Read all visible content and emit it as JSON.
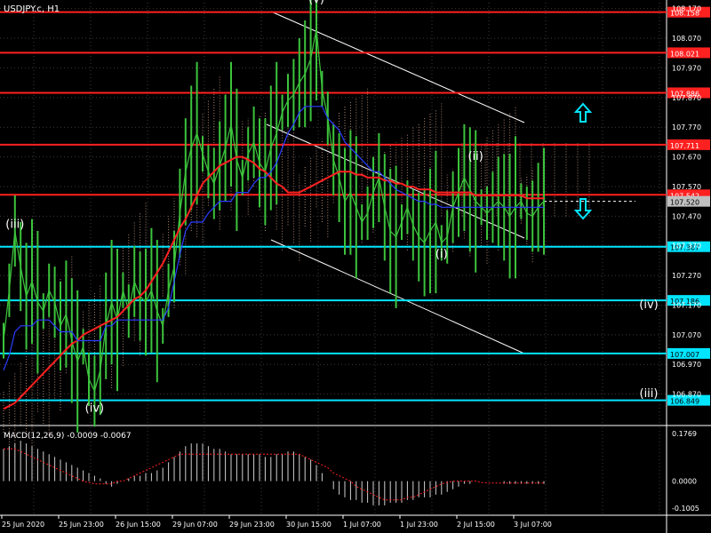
{
  "symbol_label": "USDJPY.c, H1",
  "macd_label": "MACD(12,26,9) -0.0009 -0.0067",
  "chart_data": {
    "type": "line",
    "main_axis": {
      "ylim": [
        106.77,
        108.19
      ],
      "ticks": [
        "108.170",
        "108.070",
        "107.970",
        "107.870",
        "107.770",
        "107.670",
        "107.570",
        "107.470",
        "107.370",
        "107.270",
        "107.170",
        "107.070",
        "106.970",
        "106.870"
      ]
    },
    "time_labels": [
      "25 Jun 2020",
      "25 Jun 23:00",
      "26 Jun 15:00",
      "29 Jun 07:00",
      "29 Jun 23:00",
      "30 Jun 15:00",
      "1 Jul 07:00",
      "1 Jul 23:00",
      "2 Jul 15:00",
      "3 Jul 07:00"
    ],
    "horizontal_levels": [
      {
        "label": "108.158",
        "value": 108.158,
        "color": "#ff2020"
      },
      {
        "label": "108.021",
        "value": 108.021,
        "color": "#ff2020"
      },
      {
        "label": "107.886",
        "value": 107.886,
        "color": "#ff2020"
      },
      {
        "label": "107.711",
        "value": 107.711,
        "color": "#ff2020"
      },
      {
        "label": "107.542",
        "value": 107.542,
        "color": "#ff2020"
      },
      {
        "label": "107.367",
        "value": 107.367,
        "color": "#00e5ff"
      },
      {
        "label": "107.186",
        "value": 107.186,
        "color": "#00e5ff"
      },
      {
        "label": "107.007",
        "value": 107.007,
        "color": "#00e5ff"
      },
      {
        "label": "106.849",
        "value": 106.849,
        "color": "#00e5ff"
      }
    ],
    "current_price": {
      "label": "107.520",
      "value": 107.52
    },
    "wave_labels": [
      {
        "text": "(iii)",
        "series_index": 2,
        "value": 107.43
      },
      {
        "text": "(iv)",
        "series_index": 16,
        "value": 106.81
      },
      {
        "text": "(v)",
        "series_index": 55,
        "value": 108.19
      },
      {
        "text": "(i)",
        "series_index": 77,
        "value": 107.33
      },
      {
        "text": "(ii)",
        "series_index": 83,
        "value": 107.66
      },
      {
        "text": "(iv)",
        "right_column": true,
        "value": 107.16
      },
      {
        "text": "(iii)",
        "right_column": true,
        "value": 106.86
      }
    ],
    "series": [
      {
        "name": "",
        "color": "#3cc33c",
        "values": [
          107.05,
          107.22,
          107.42,
          107.3,
          107.2,
          107.25,
          107.18,
          107.15,
          107.22,
          107.18,
          107.1,
          107.14,
          107.05,
          106.98,
          107.03,
          106.92,
          106.88,
          106.95,
          107.1,
          107.18,
          107.12,
          107.22,
          107.15,
          107.25,
          107.2,
          107.18,
          107.22,
          107.15,
          107.1,
          107.22,
          107.3,
          107.48,
          107.62,
          107.7,
          107.75,
          107.68,
          107.62,
          107.58,
          107.64,
          107.7,
          107.78,
          107.66,
          107.6,
          107.68,
          107.72,
          107.65,
          107.62,
          107.7,
          107.75,
          107.82,
          107.86,
          107.88,
          107.92,
          107.95,
          108.0,
          108.1,
          107.9,
          107.8,
          107.66,
          107.6,
          107.52,
          107.55,
          107.5,
          107.45,
          107.48,
          107.55,
          107.6,
          107.5,
          107.42,
          107.4,
          107.45,
          107.5,
          107.44,
          107.4,
          107.38,
          107.42,
          107.45,
          107.38,
          107.4,
          107.5,
          107.55,
          107.6,
          107.56,
          107.52,
          107.5,
          107.48,
          107.5,
          107.52,
          107.5,
          107.47,
          107.5,
          107.52,
          107.48,
          107.47,
          107.5,
          107.52
        ]
      },
      {
        "name": "",
        "color": "#ff2020",
        "values": [
          106.82,
          106.83,
          106.84,
          106.86,
          106.88,
          106.9,
          106.92,
          106.94,
          106.96,
          106.98,
          107.0,
          107.02,
          107.04,
          107.05,
          107.07,
          107.08,
          107.09,
          107.1,
          107.11,
          107.12,
          107.13,
          107.15,
          107.17,
          107.19,
          107.2,
          107.22,
          107.25,
          107.28,
          107.31,
          107.35,
          107.39,
          107.43,
          107.46,
          107.5,
          107.54,
          107.58,
          107.6,
          107.62,
          107.64,
          107.65,
          107.66,
          107.67,
          107.67,
          107.66,
          107.65,
          107.63,
          107.62,
          107.6,
          107.58,
          107.57,
          107.55,
          107.55,
          107.55,
          107.56,
          107.57,
          107.58,
          107.59,
          107.6,
          107.61,
          107.62,
          107.62,
          107.62,
          107.61,
          107.61,
          107.6,
          107.6,
          107.6,
          107.59,
          107.59,
          107.58,
          107.58,
          107.57,
          107.57,
          107.56,
          107.56,
          107.56,
          107.55,
          107.55,
          107.55,
          107.55,
          107.55,
          107.55,
          107.55,
          107.54,
          107.54,
          107.54,
          107.54,
          107.54,
          107.54,
          107.54,
          107.54,
          107.54,
          107.53,
          107.53,
          107.53,
          107.53
        ]
      },
      {
        "name": "",
        "color": "#2a3dff",
        "values": [
          106.95,
          107.0,
          107.08,
          107.1,
          107.1,
          107.1,
          107.12,
          107.12,
          107.12,
          107.1,
          107.08,
          107.08,
          107.08,
          107.05,
          107.05,
          107.05,
          107.05,
          107.05,
          107.1,
          107.1,
          107.12,
          107.12,
          107.12,
          107.12,
          107.12,
          107.12,
          107.12,
          107.12,
          107.12,
          107.16,
          107.25,
          107.34,
          107.42,
          107.45,
          107.45,
          107.45,
          107.48,
          107.5,
          107.52,
          107.52,
          107.52,
          107.55,
          107.55,
          107.55,
          107.58,
          107.6,
          107.6,
          107.62,
          107.65,
          107.7,
          107.75,
          107.78,
          107.82,
          107.84,
          107.84,
          107.84,
          107.84,
          107.8,
          107.78,
          107.76,
          107.72,
          107.7,
          107.68,
          107.66,
          107.64,
          107.62,
          107.62,
          107.6,
          107.58,
          107.56,
          107.55,
          107.54,
          107.53,
          107.52,
          107.52,
          107.51,
          107.51,
          107.5,
          107.5,
          107.5,
          107.5,
          107.5,
          107.5,
          107.5,
          107.5,
          107.5,
          107.5,
          107.5,
          107.5,
          107.5,
          107.5,
          107.5,
          107.5,
          107.5,
          107.5,
          107.5
        ]
      }
    ],
    "macd_panel": {
      "ticks": [
        "0.1769",
        "0.0000",
        "-0.1005"
      ],
      "ylim": [
        -0.12,
        0.2
      ],
      "histogram": [
        0.12,
        0.13,
        0.14,
        0.15,
        0.14,
        0.13,
        0.12,
        0.11,
        0.1,
        0.09,
        0.08,
        0.07,
        0.06,
        0.05,
        0.04,
        0.03,
        0.02,
        0.01,
        -0.01,
        -0.02,
        -0.01,
        0.0,
        0.01,
        0.02,
        0.02,
        0.03,
        0.03,
        0.04,
        0.05,
        0.07,
        0.09,
        0.11,
        0.13,
        0.14,
        0.14,
        0.14,
        0.13,
        0.12,
        0.12,
        0.11,
        0.1,
        0.1,
        0.1,
        0.1,
        0.1,
        0.1,
        0.09,
        0.09,
        0.1,
        0.1,
        0.11,
        0.11,
        0.1,
        0.09,
        0.08,
        0.06,
        0.03,
        0.0,
        -0.03,
        -0.05,
        -0.06,
        -0.07,
        -0.07,
        -0.08,
        -0.08,
        -0.09,
        -0.09,
        -0.09,
        -0.08,
        -0.08,
        -0.08,
        -0.07,
        -0.07,
        -0.06,
        -0.06,
        -0.06,
        -0.05,
        -0.05,
        -0.04,
        -0.03,
        -0.02,
        -0.01,
        -0.01,
        0.0,
        0.0,
        0.0,
        0.0,
        0.0,
        -0.01,
        -0.01,
        -0.01,
        -0.01,
        -0.01,
        -0.01,
        -0.01,
        -0.01
      ],
      "signal": [
        0.12,
        0.12,
        0.12,
        0.11,
        0.1,
        0.09,
        0.08,
        0.07,
        0.06,
        0.05,
        0.04,
        0.03,
        0.02,
        0.01,
        0.0,
        -0.005,
        -0.01,
        -0.01,
        -0.01,
        -0.01,
        0.0,
        0.0,
        0.01,
        0.02,
        0.03,
        0.04,
        0.05,
        0.06,
        0.07,
        0.08,
        0.09,
        0.1,
        0.1,
        0.1,
        0.1,
        0.1,
        0.1,
        0.1,
        0.1,
        0.1,
        0.1,
        0.1,
        0.1,
        0.1,
        0.1,
        0.1,
        0.1,
        0.1,
        0.1,
        0.1,
        0.1,
        0.1,
        0.1,
        0.09,
        0.08,
        0.07,
        0.06,
        0.05,
        0.03,
        0.02,
        0.01,
        0.0,
        -0.02,
        -0.03,
        -0.04,
        -0.05,
        -0.06,
        -0.07,
        -0.07,
        -0.07,
        -0.07,
        -0.06,
        -0.06,
        -0.05,
        -0.04,
        -0.03,
        -0.02,
        -0.01,
        -0.005,
        0.0,
        0.0,
        0.0,
        0.0,
        0.0,
        -0.005,
        -0.007,
        -0.007,
        -0.007,
        -0.007,
        -0.007,
        -0.007,
        -0.007,
        -0.007,
        -0.007,
        -0.007,
        -0.007
      ]
    },
    "grid": true,
    "arrows": [
      {
        "direction": "up",
        "color": "#00e5ff"
      },
      {
        "direction": "down",
        "color": "#00e5ff"
      }
    ]
  }
}
